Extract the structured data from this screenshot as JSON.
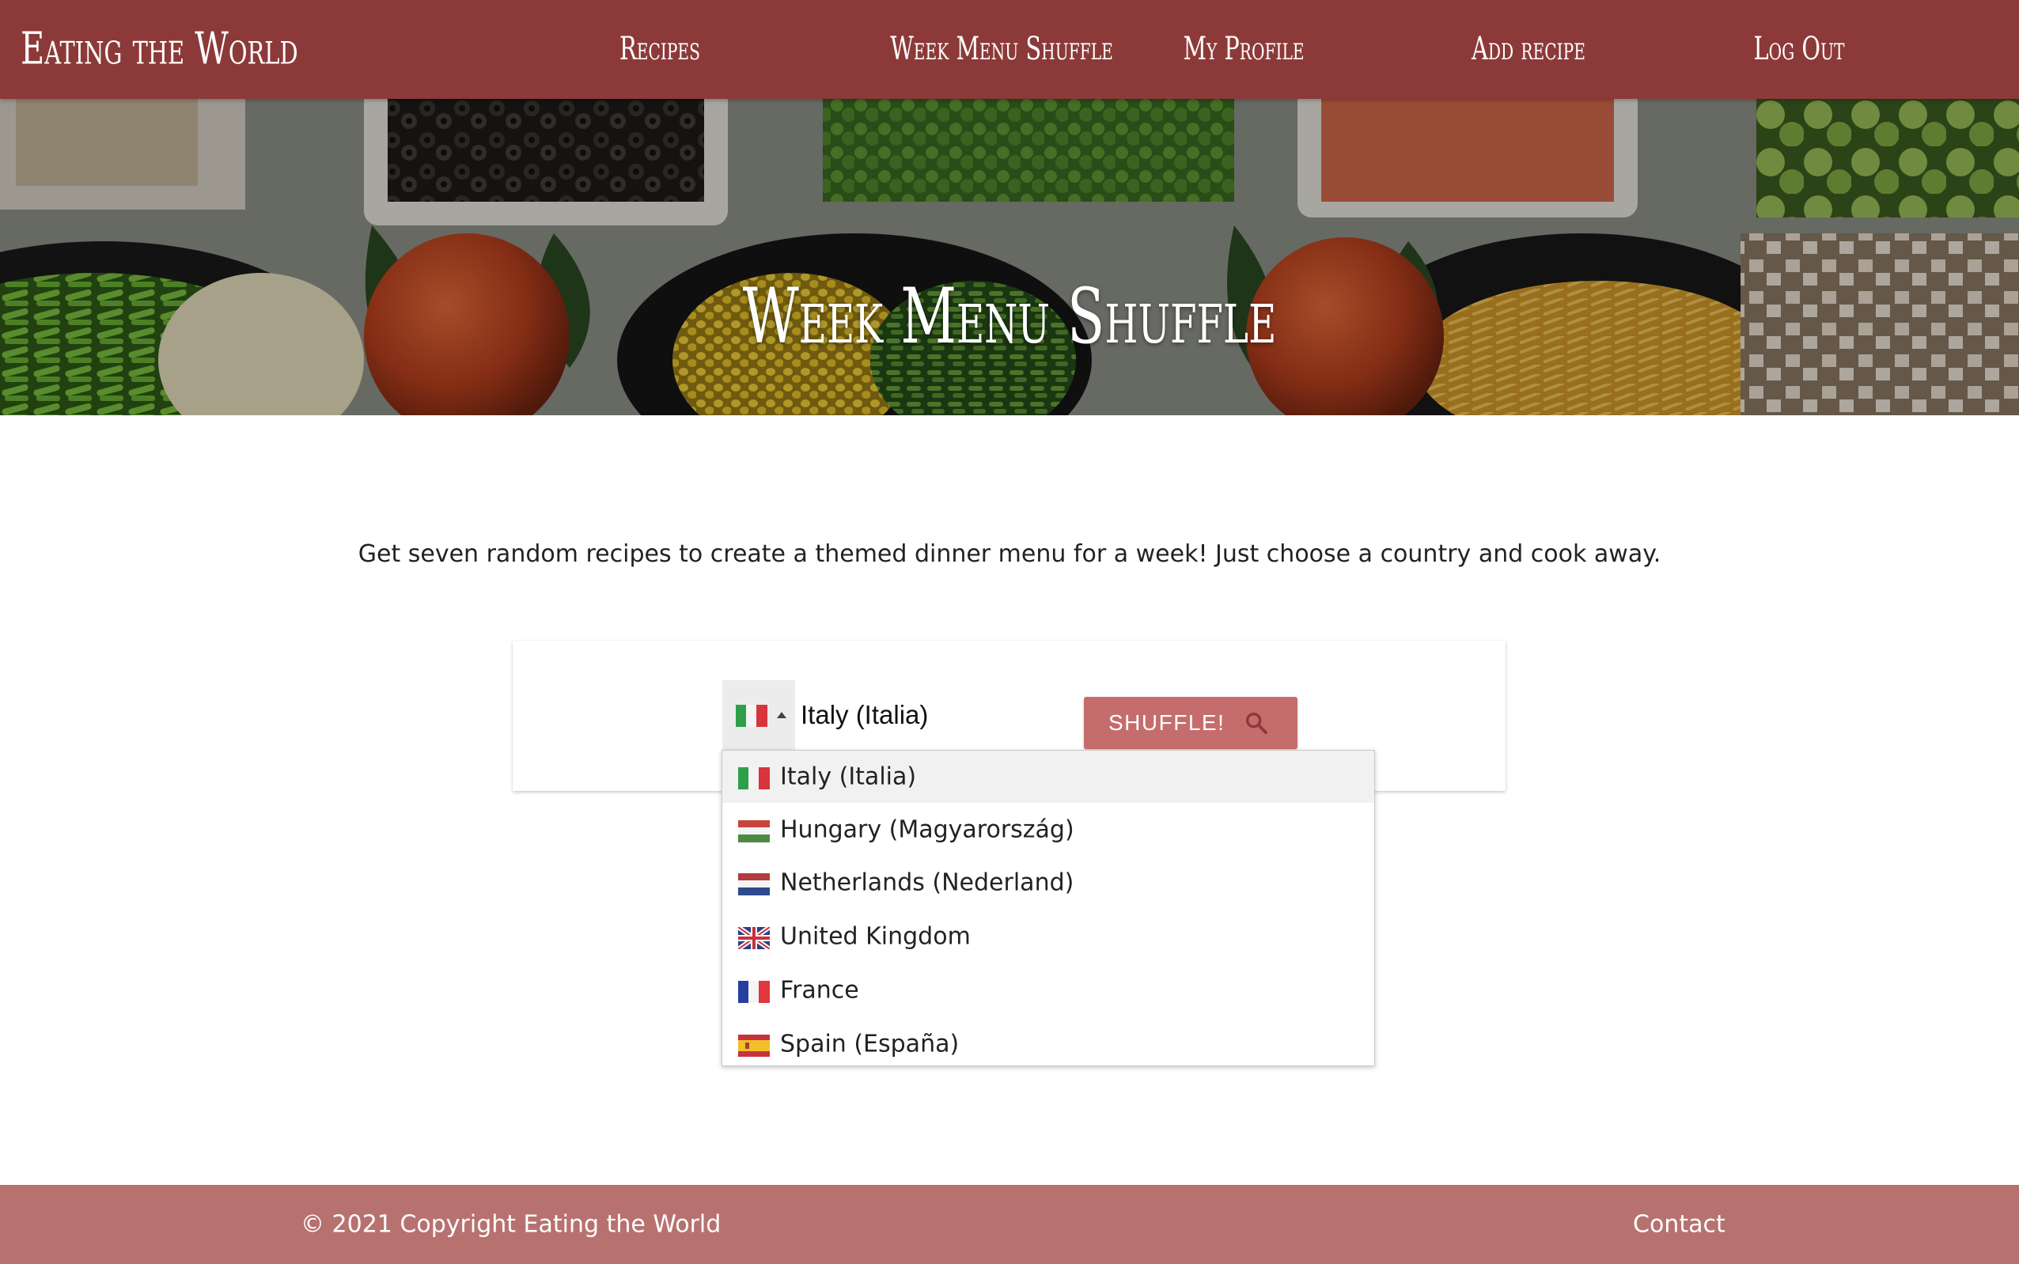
{
  "navbar": {
    "brand": "Eating the World",
    "items": [
      {
        "label": "Recipes"
      },
      {
        "label": "Week Menu Shuffle"
      },
      {
        "label": "My Profile"
      },
      {
        "label": "Add recipe"
      },
      {
        "label": "Log Out"
      }
    ]
  },
  "hero": {
    "title": "Week Menu Shuffle"
  },
  "main": {
    "intro": "Get seven random recipes to create a themed dinner menu for a week! Just choose a country and cook away.",
    "country_picker": {
      "selected_value": "Italy (Italia)",
      "selected_flag": "italy-flag-icon",
      "caret_icon": "caret-up-icon"
    },
    "shuffle_button": {
      "label": "SHUFFLE!",
      "icon": "search-icon"
    },
    "dropdown": {
      "options": [
        {
          "label": "Italy (Italia)",
          "flag": "italy-flag-icon",
          "selected": true
        },
        {
          "label": "Hungary (Magyarország)",
          "flag": "hungary-flag-icon",
          "selected": false
        },
        {
          "label": "Netherlands (Nederland)",
          "flag": "netherlands-flag-icon",
          "selected": false
        },
        {
          "label": "United Kingdom",
          "flag": "uk-flag-icon",
          "selected": false
        },
        {
          "label": "France",
          "flag": "france-flag-icon",
          "selected": false
        },
        {
          "label": "Spain (España)",
          "flag": "spain-flag-icon",
          "selected": false
        }
      ]
    }
  },
  "footer": {
    "copyright": "© 2021 Copyright Eating the World",
    "contact": "Contact"
  },
  "colors": {
    "navbar_bg": "#8c3a39",
    "button_bg": "#c56d6c",
    "footer_bg": "#b77270",
    "selected_option_bg": "#f1f1f1"
  }
}
